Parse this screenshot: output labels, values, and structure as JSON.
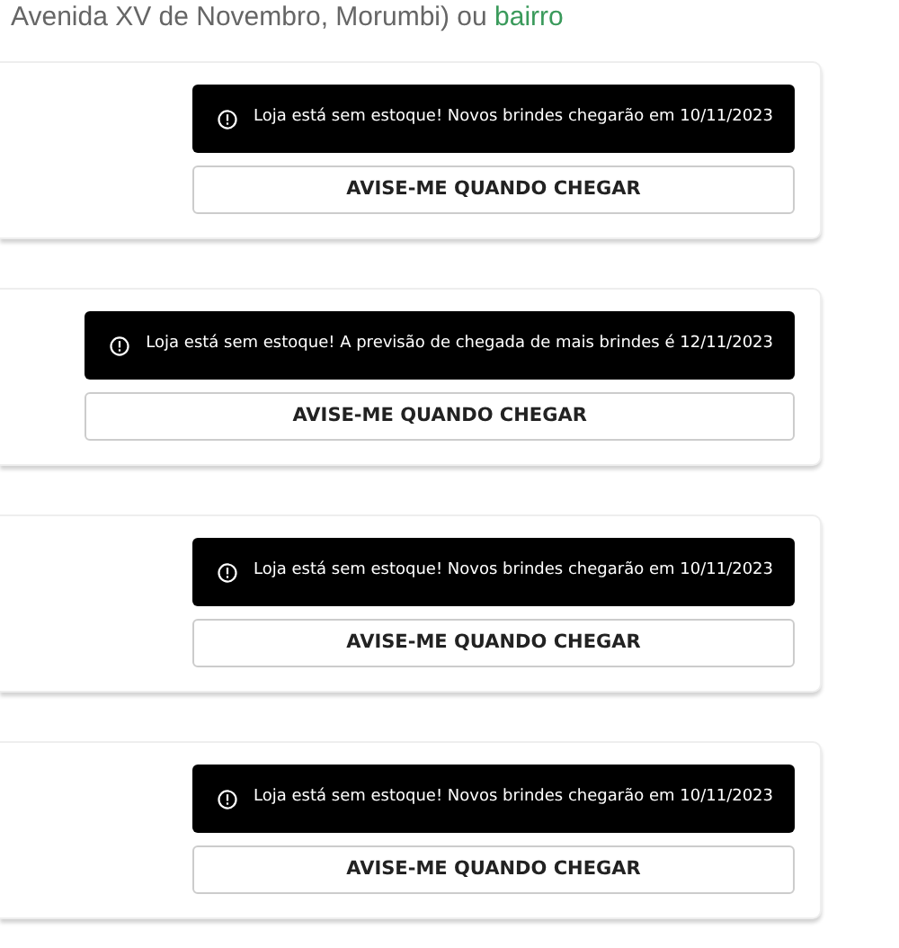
{
  "intro": {
    "text": "Avenida XV de Novembro, Morumbi) ou",
    "link": "bairro"
  },
  "stores": [
    {
      "alert": "Loja está sem estoque! Novos brindes chegarão em 10/11/2023",
      "button": "AVISE-ME QUANDO CHEGAR"
    },
    {
      "alert": "Loja está sem estoque! A previsão de chegada de mais brindes é 12/11/2023",
      "button": "AVISE-ME QUANDO CHEGAR"
    },
    {
      "alert": "Loja está sem estoque! Novos brindes chegarão em 10/11/2023",
      "button": "AVISE-ME QUANDO CHEGAR"
    },
    {
      "alert": "Loja está sem estoque! Novos brindes chegarão em 10/11/2023",
      "button": "AVISE-ME QUANDO CHEGAR"
    }
  ]
}
